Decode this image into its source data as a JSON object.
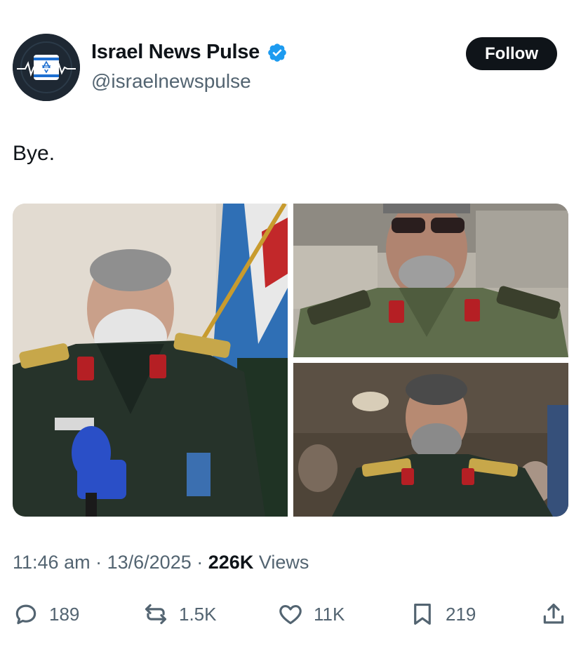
{
  "author": {
    "display_name": "Israel News Pulse",
    "handle": "@israelnewspulse",
    "verified": true
  },
  "follow_button": {
    "label": "Follow"
  },
  "tweet": {
    "text": "Bye."
  },
  "media": {
    "count": 3,
    "alt": [
      "Man in dark green military uniform speaking at a microphone with flag behind",
      "Man in sunglasses and olive green military uniform",
      "Man in dark green military uniform seated in a crowd"
    ]
  },
  "meta": {
    "time": "11:46 am",
    "separator": "·",
    "date": "13/6/2025",
    "views_count": "226K",
    "views_label": "Views"
  },
  "actions": {
    "replies": "189",
    "reposts": "1.5K",
    "likes": "11K",
    "bookmarks": "219"
  },
  "colors": {
    "text_primary": "#0f1419",
    "text_secondary": "#536471",
    "verified_blue": "#1d9bf0",
    "follow_bg": "#0f1419"
  },
  "icons": [
    "verified-badge-icon",
    "reply-icon",
    "repost-icon",
    "like-icon",
    "bookmark-icon",
    "share-icon"
  ]
}
